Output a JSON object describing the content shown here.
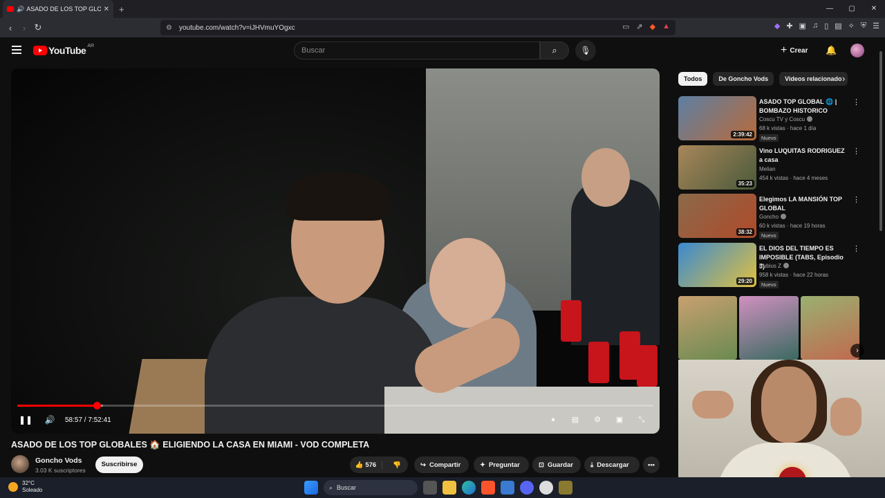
{
  "browser": {
    "tab_title": "ASADO DE LOS TOP GLOBALE",
    "url": "youtube.com/watch?v=iJHVmuYOgxc"
  },
  "header": {
    "logo_text": "YouTube",
    "country_code": "AR",
    "search_placeholder": "Buscar",
    "create_label": "Crear"
  },
  "player": {
    "time": "58:57 / 7:52:41",
    "progress_played": 0.125,
    "progress_loaded": 0.135
  },
  "video": {
    "title": "ASADO DE LOS TOP GLOBALES 🏠 ELIGIENDO LA CASA EN MIAMI - VOD COMPLETA",
    "channel": "Goncho Vods",
    "subscribers": "3.03 K suscriptores",
    "subscribe_label": "Suscribirse",
    "likes": "576",
    "share_label": "Compartir",
    "ask_label": "Preguntar",
    "save_label": "Guardar",
    "download_label": "Descargar"
  },
  "sidebar": {
    "chips": [
      "Todos",
      "De Goncho Vods",
      "Videos relacionado"
    ],
    "recommendations": [
      {
        "title": "ASADO TOP GLOBAL 🌐 | BOMBAZO HISTORICO",
        "channel": "Coscu TV y Coscu",
        "meta": "68 k vistas · hace 1 día",
        "duration": "2:39:42",
        "badge": "Nuevo",
        "colors": [
          "#5d7fa3",
          "#b86a3a"
        ]
      },
      {
        "title": "Vino LUQUITAS RODRIGUEZ a casa",
        "channel": "Melian",
        "meta": "454 k vistas · hace 4 meses",
        "duration": "35:23",
        "badge": "",
        "colors": [
          "#a8865a",
          "#4a5a3a"
        ]
      },
      {
        "title": "Elegimos LA MANSIÓN TOP GLOBAL",
        "channel": "Goncho",
        "meta": "60 k vistas · hace 19 horas",
        "duration": "38:32",
        "badge": "Nuevo",
        "colors": [
          "#8a6a4a",
          "#b04a2a"
        ]
      },
      {
        "title": "EL DIOS DEL TIEMPO ES IMPOSIBLE (TABS, Episodio 3)",
        "channel": "Rubius Z",
        "meta": "958 k vistas · hace 22 horas",
        "duration": "29:20",
        "badge": "Nuevo",
        "colors": [
          "#3a8ad0",
          "#e0c040"
        ]
      }
    ]
  },
  "taskbar": {
    "temperature": "32°C",
    "condition": "Soleado",
    "search_label": "Buscar"
  }
}
